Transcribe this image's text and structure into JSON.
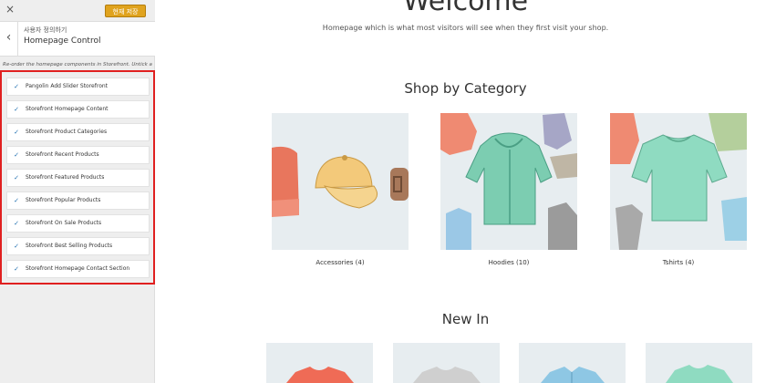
{
  "customizer": {
    "close_icon": "×",
    "publish_label": "현재 저장",
    "back_icon": "‹",
    "section_crumb": "사용자 정의하기",
    "section_title": "Homepage Control",
    "description": "Re-order the homepage components in Storefront. Untick a component to hide it.",
    "components": [
      {
        "label": "Pangolin Add Slider Storefront",
        "checked": true
      },
      {
        "label": "Storefront Homepage Content",
        "checked": true
      },
      {
        "label": "Storefront Product Categories",
        "checked": true
      },
      {
        "label": "Storefront Recent Products",
        "checked": true
      },
      {
        "label": "Storefront Featured Products",
        "checked": true
      },
      {
        "label": "Storefront Popular Products",
        "checked": true
      },
      {
        "label": "Storefront On Sale Products",
        "checked": true
      },
      {
        "label": "Storefront Best Selling Products",
        "checked": true
      },
      {
        "label": "Storefront Homepage Contact Section",
        "checked": true
      }
    ],
    "check_glyph": "✓",
    "highlight_color": "#e02020"
  },
  "preview": {
    "welcome_title": "Welcome",
    "welcome_subtitle": "Homepage which is what most visitors will see when they first visit your shop.",
    "category_heading": "Shop by Category",
    "categories": [
      {
        "name": "Accessories (4)"
      },
      {
        "name": "Hoodies (10)"
      },
      {
        "name": "Tshirts (4)"
      }
    ],
    "new_in_heading": "New In"
  }
}
